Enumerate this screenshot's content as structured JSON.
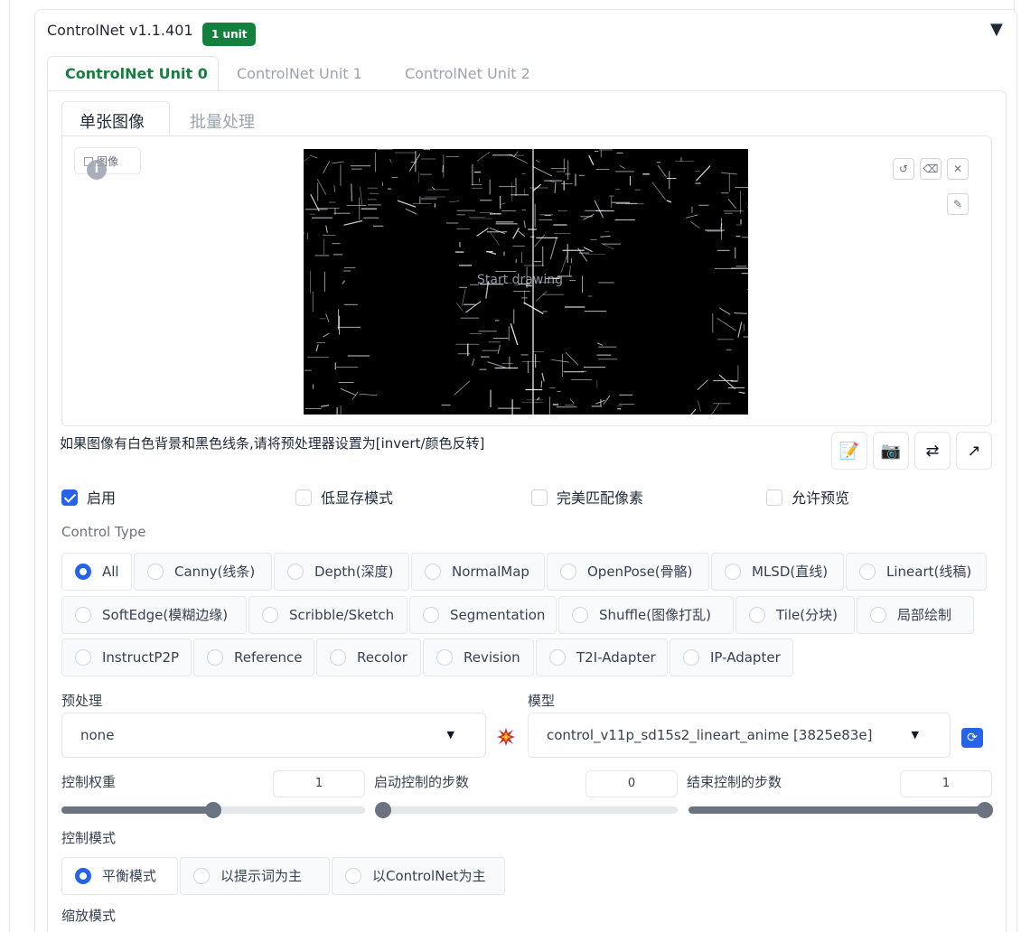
{
  "extension": {
    "title": "ControlNet v1.1.401",
    "badge": "1 unit"
  },
  "unit_tabs": [
    "ControlNet Unit 0",
    "ControlNet Unit 1",
    "ControlNet Unit 2"
  ],
  "image_tabs": [
    "单张图像",
    "批量处理"
  ],
  "image_panel": {
    "label": "图像",
    "canvas_overlay": "Start drawing",
    "hint": "如果图像有白色背景和黑色线条,请将预处理器设置为[invert/颜色反转]"
  },
  "options": {
    "enable": {
      "label": "启用",
      "checked": true
    },
    "low_vram": {
      "label": "低显存模式",
      "checked": false
    },
    "pixel_perfect": {
      "label": "完美匹配像素",
      "checked": false
    },
    "allow_preview": {
      "label": "允许预览",
      "checked": false
    }
  },
  "control_type": {
    "label": "Control Type",
    "selected": "All",
    "options": [
      "All",
      "Canny(线条)",
      "Depth(深度)",
      "NormalMap",
      "OpenPose(骨骼)",
      "MLSD(直线)",
      "Lineart(线稿)",
      "SoftEdge(模糊边缘)",
      "Scribble/Sketch",
      "Segmentation",
      "Shuffle(图像打乱)",
      "Tile(分块)",
      "局部绘制",
      "InstructP2P",
      "Reference",
      "Recolor",
      "Revision",
      "T2I-Adapter",
      "IP-Adapter"
    ]
  },
  "preprocessor": {
    "label": "预处理",
    "value": "none"
  },
  "model": {
    "label": "模型",
    "value": "control_v11p_sd15s2_lineart_anime [3825e83e]"
  },
  "sliders": {
    "weight": {
      "label": "控制权重",
      "value": "1",
      "fraction": 0.5
    },
    "start": {
      "label": "启动控制的步数",
      "value": "0",
      "fraction": 0.0
    },
    "end": {
      "label": "结束控制的步数",
      "value": "1",
      "fraction": 1.0
    }
  },
  "control_mode": {
    "label": "控制模式",
    "selected": "平衡模式",
    "options": [
      "平衡模式",
      "以提示词为主",
      "以ControlNet为主"
    ]
  },
  "resize_mode": {
    "label": "缩放模式"
  },
  "icons": {
    "collapse": "triangle-down-icon",
    "undo": "undo-icon",
    "erase": "eraser-icon",
    "close": "close-icon",
    "brush": "brush-icon",
    "new_canvas": "edit-icon",
    "webcam": "camera-icon",
    "swap": "swap-icon",
    "send": "send-dimensions-icon",
    "run_preprocessor": "explosion-icon",
    "refresh": "refresh-icon"
  },
  "colors": {
    "accent_green": "#15803d",
    "accent_blue": "#2563eb"
  }
}
